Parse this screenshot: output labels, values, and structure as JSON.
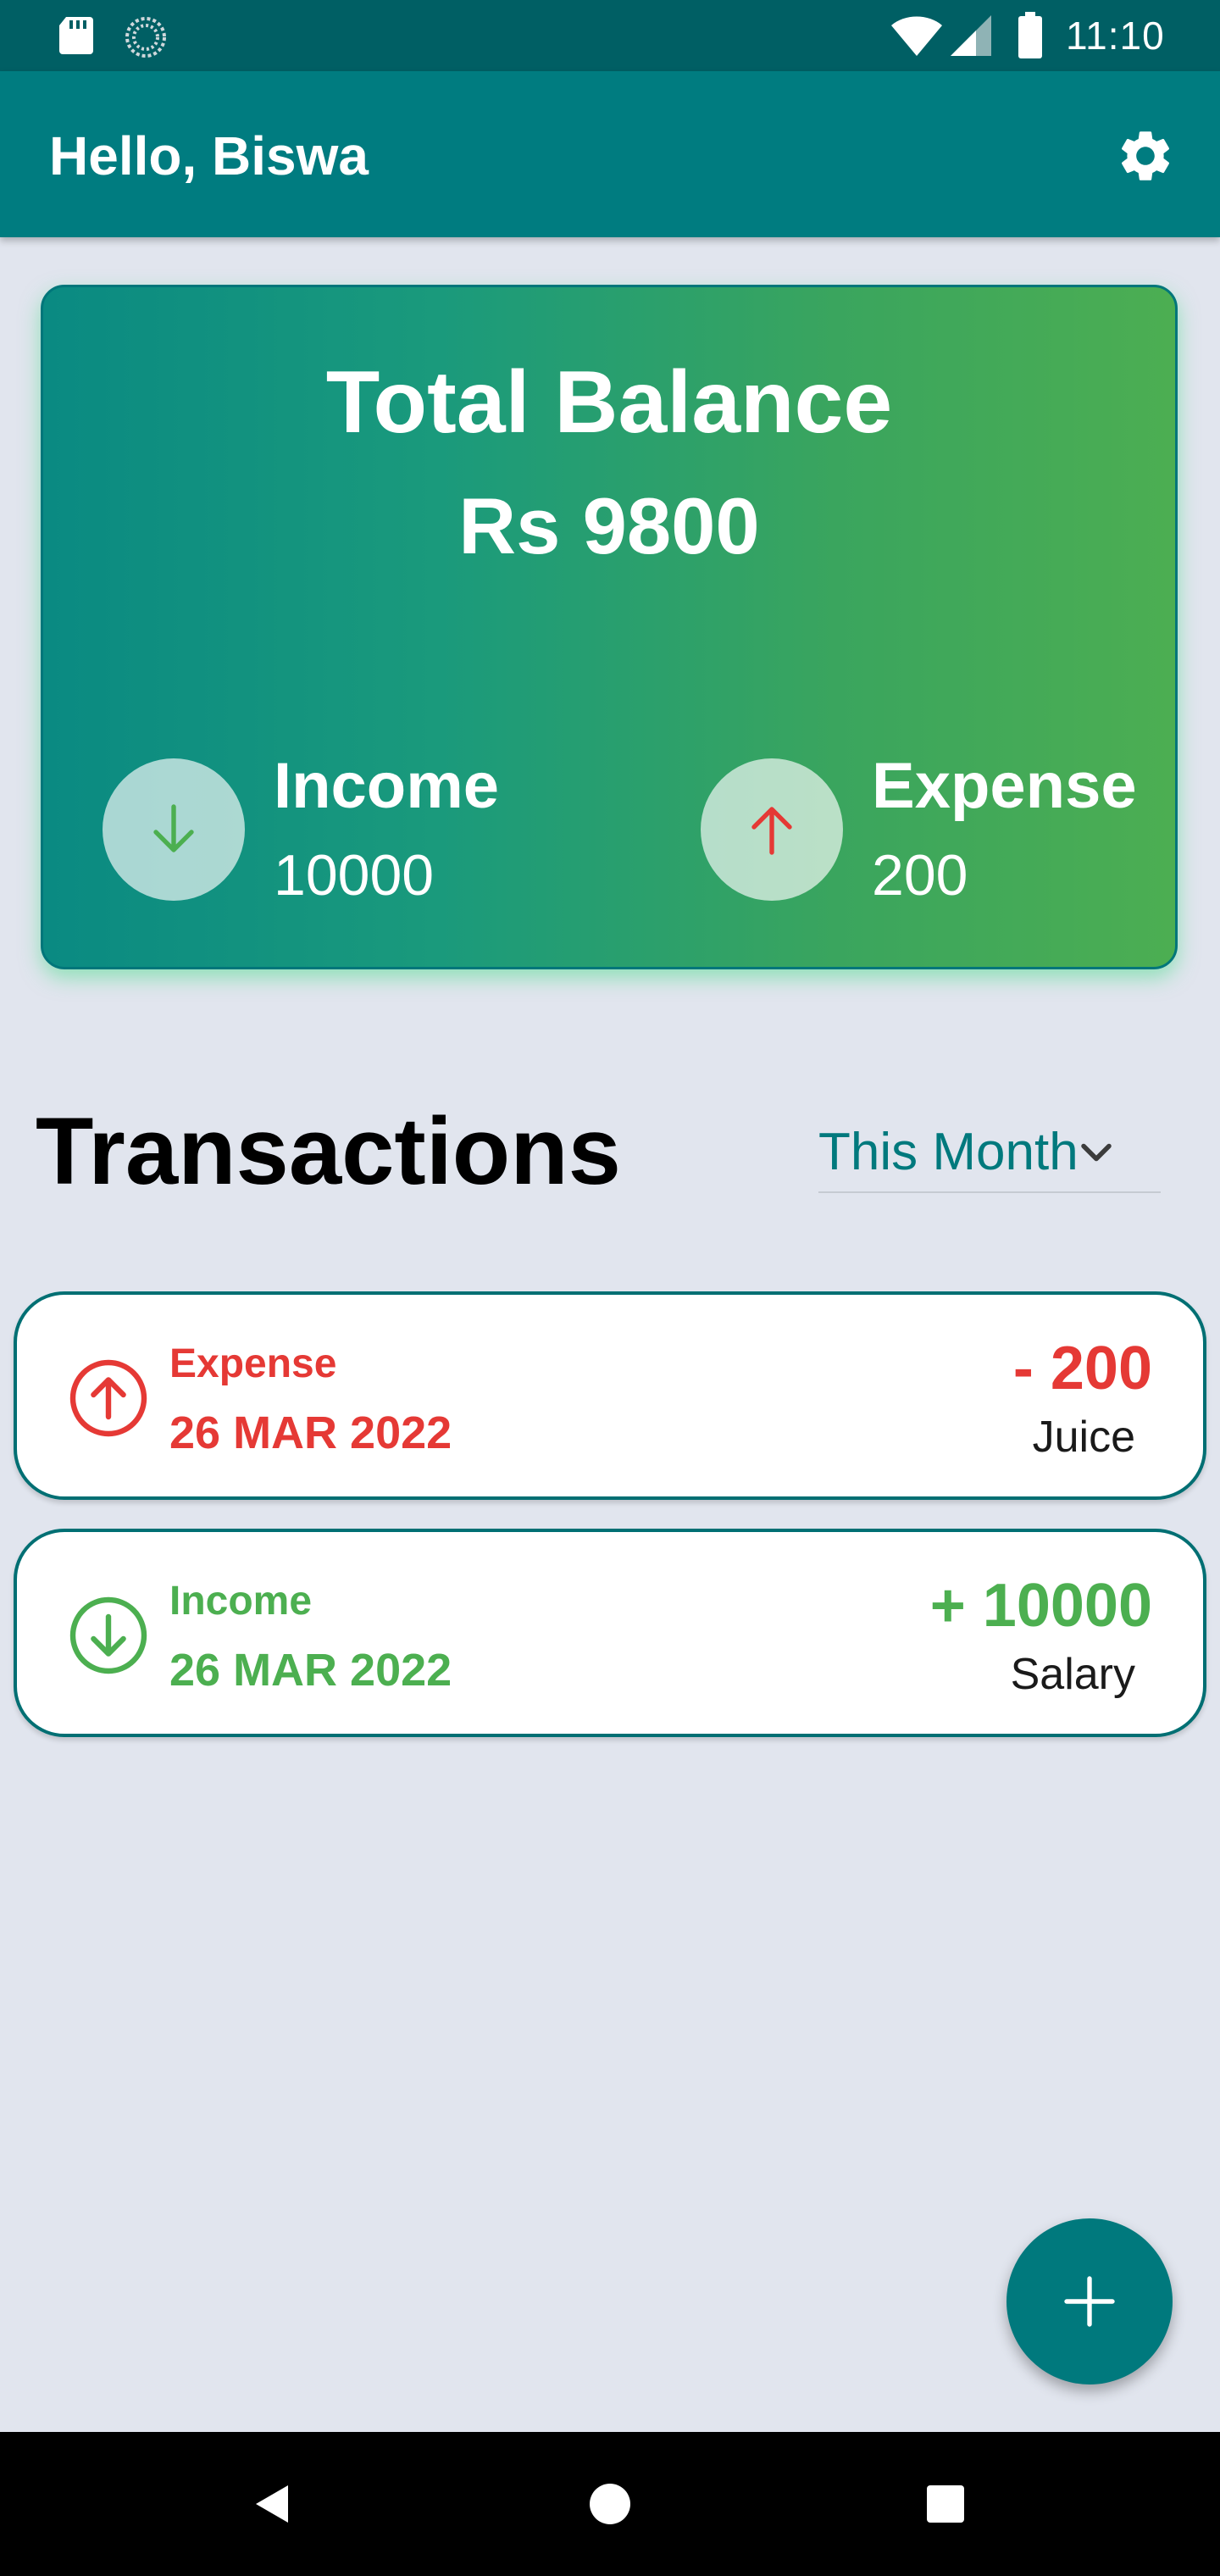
{
  "status_bar": {
    "time": "11:10",
    "icons": [
      "sd-card-icon",
      "sync-icon",
      "wifi-icon",
      "signal-icon",
      "battery-icon"
    ]
  },
  "app_bar": {
    "greeting": "Hello, Biswa",
    "settings_icon": "gear-icon"
  },
  "balance_card": {
    "title": "Total Balance",
    "amount": "Rs 9800",
    "income": {
      "label": "Income",
      "value": "10000",
      "icon": "arrow-down-icon"
    },
    "expense": {
      "label": "Expense",
      "value": "200",
      "icon": "arrow-up-icon"
    }
  },
  "transactions": {
    "heading": "Transactions",
    "period": {
      "selected": "This Month"
    },
    "items": [
      {
        "type": "Expense",
        "date": "26 MAR 2022",
        "amount": "- 200",
        "note": "Juice",
        "icon": "arrow-up-circle-icon"
      },
      {
        "type": "Income",
        "date": "26 MAR 2022",
        "amount": "+ 10000",
        "note": "Salary",
        "icon": "arrow-down-circle-icon"
      }
    ]
  },
  "fab": {
    "icon": "plus-icon"
  },
  "colors": {
    "primary": "#007c80",
    "status_bar": "#005f64",
    "expense": "#e53935",
    "income": "#4caf50",
    "background": "#e1e5ee"
  }
}
